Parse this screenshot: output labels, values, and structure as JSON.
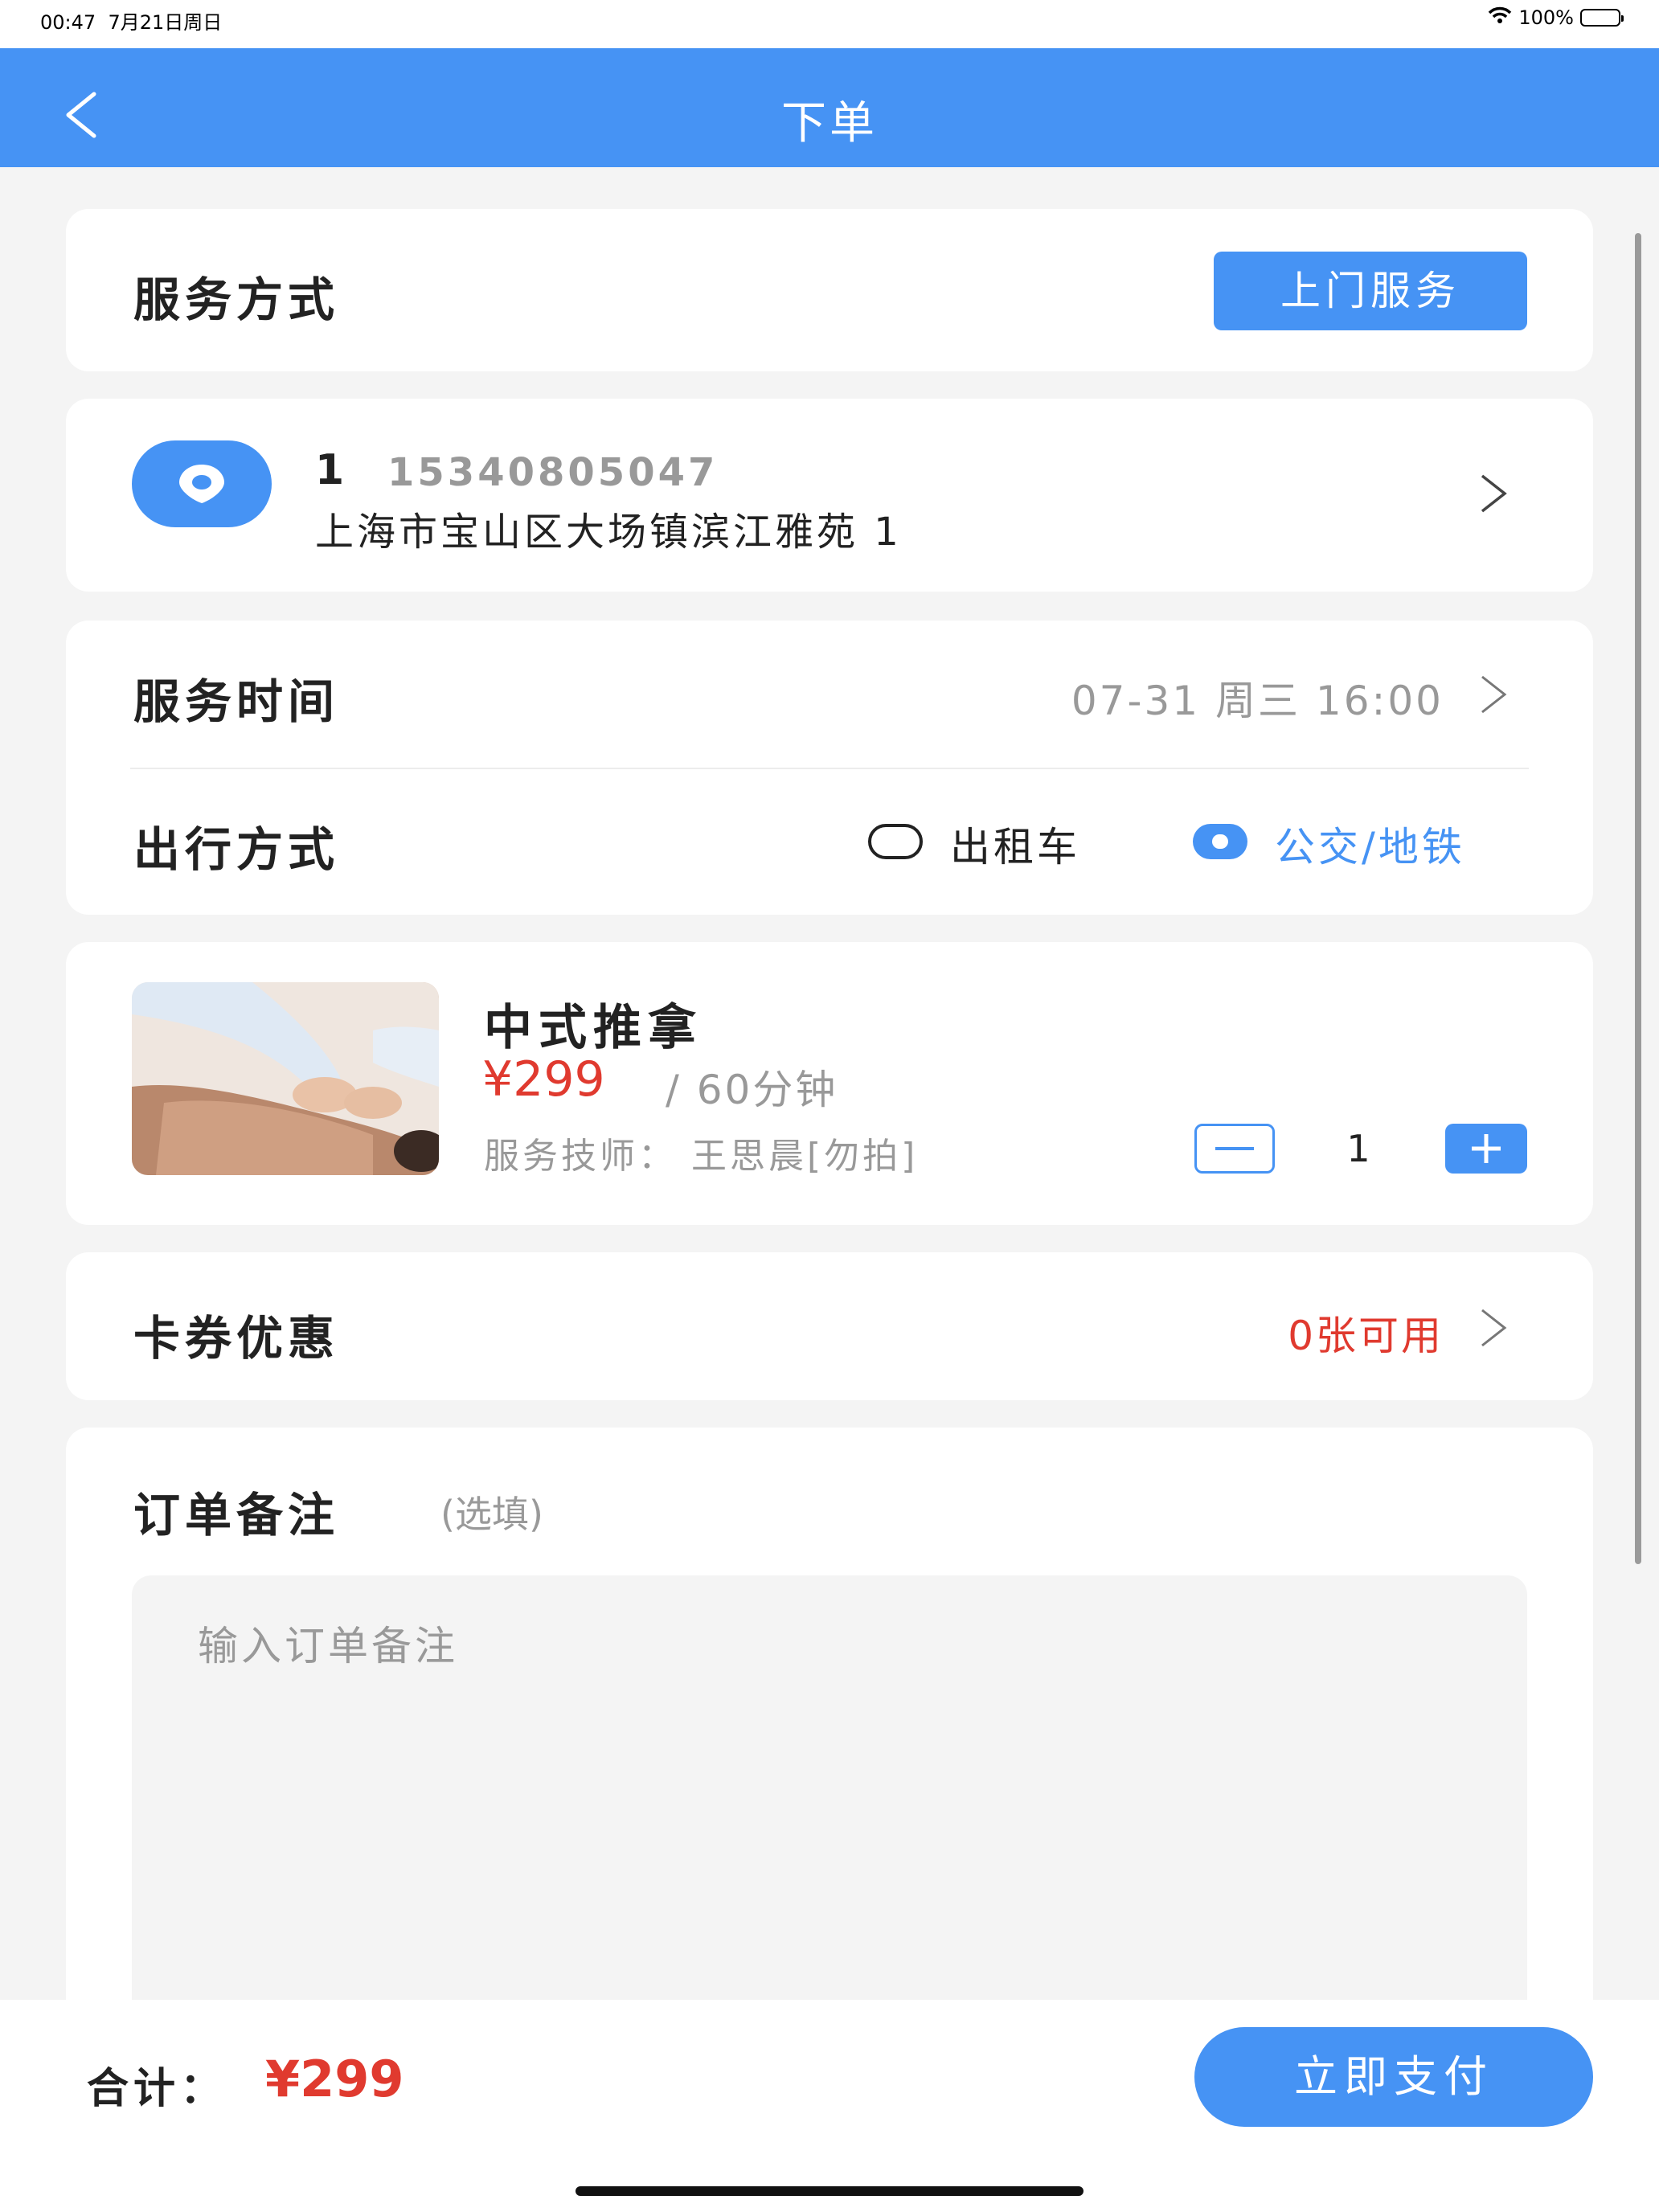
{
  "status_bar": {
    "time": "00:47",
    "date": "7月21日周日",
    "battery": "100%"
  },
  "nav": {
    "title": "下单"
  },
  "service_method": {
    "label": "服务方式",
    "button": "上门服务"
  },
  "address": {
    "name": "1",
    "phone": "15340805047",
    "detail": "上海市宝山区大场镇滨江雅苑 1"
  },
  "service_time": {
    "label": "服务时间",
    "value": "07-31 周三 16:00"
  },
  "travel": {
    "label": "出行方式",
    "options": [
      {
        "label": "出租车",
        "selected": false
      },
      {
        "label": "公交/地铁",
        "selected": true
      }
    ]
  },
  "product": {
    "name": "中式推拿",
    "price": "¥299",
    "duration": "/ 60分钟",
    "technician": "服务技师：  王思晨[勿拍]",
    "quantity": "1"
  },
  "coupon": {
    "label": "卡券优惠",
    "value": "0张可用"
  },
  "remark": {
    "label": "订单备注",
    "hint": "(选填)",
    "placeholder": "输入订单备注"
  },
  "footer": {
    "total_label": "合计：",
    "total_value": "¥299",
    "pay_button": "立即支付"
  },
  "colors": {
    "primary": "#4693f4",
    "price_red": "#e03a2f",
    "background": "#f4f4f4"
  }
}
